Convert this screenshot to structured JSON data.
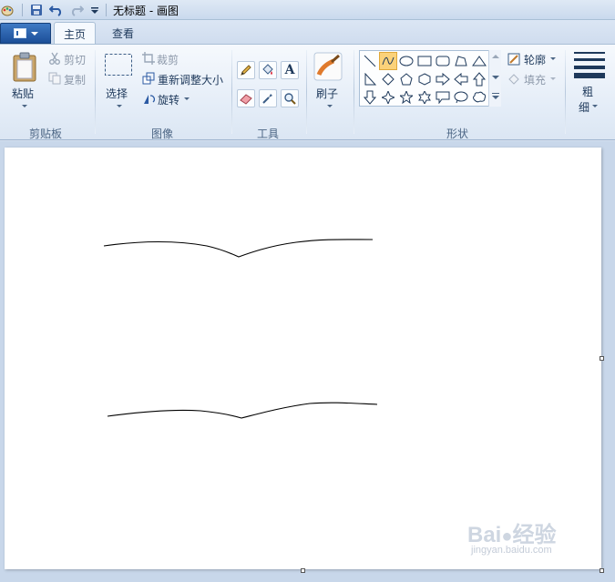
{
  "titlebar": {
    "title": "无标题 - 画图"
  },
  "tabs": {
    "home": "主页",
    "view": "查看"
  },
  "clipboard": {
    "paste": "粘贴",
    "cut": "剪切",
    "copy": "复制",
    "group": "剪贴板"
  },
  "image": {
    "select": "选择",
    "crop": "裁剪",
    "resize": "重新调整大小",
    "rotate": "旋转",
    "group": "图像"
  },
  "tools": {
    "group": "工具",
    "text_tool_glyph": "A"
  },
  "brushes": {
    "label": "刷子"
  },
  "shapes": {
    "outline": "轮廓",
    "fill": "填充",
    "group": "形状"
  },
  "size": {
    "label_line1": "粗",
    "label_line2": "细"
  },
  "watermark": {
    "brand": "Bai",
    "brand_cn": "经验",
    "url": "jingyan.baidu.com"
  }
}
